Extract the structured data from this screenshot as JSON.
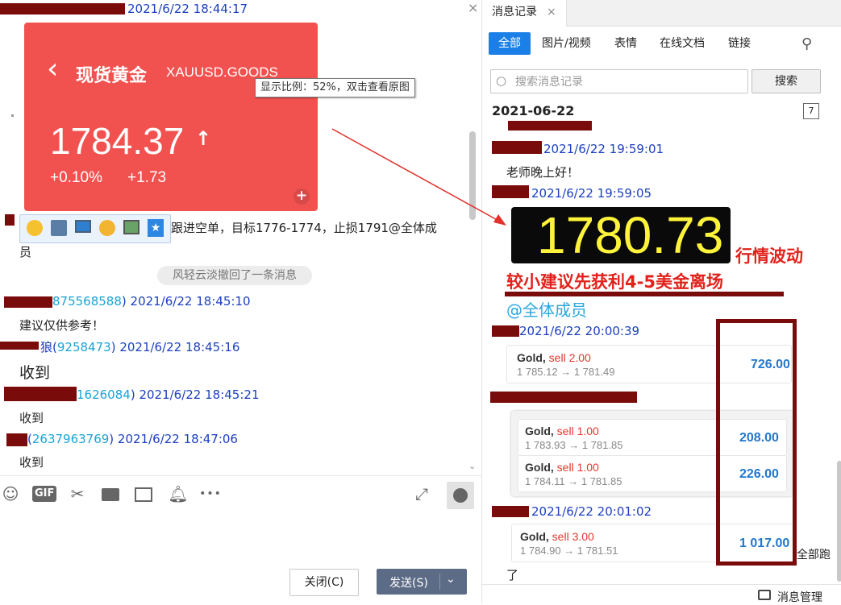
{
  "left": {
    "messages": [
      {
        "time": "2021/6/22 18:44:17"
      },
      {
        "text": "跟进空单，目标1776-1774，止损1791@全体成",
        "text2": "员"
      },
      {
        "recall": "风轻云淡撤回了一条消息"
      },
      {
        "id": "875568588",
        "time": "2021/6/22 18:45:10",
        "text": "建议仅供参考！"
      },
      {
        "prefix": "狼",
        "id": "9258473",
        "time": "2021/6/22 18:45:16",
        "text": "收到"
      },
      {
        "id": "1626084",
        "time": "2021/6/22 18:45:21",
        "text": "收到"
      },
      {
        "id": "2637963769",
        "time": "2021/6/22 18:47:06",
        "text": "收到"
      }
    ],
    "stock": {
      "back": "‹",
      "name": "现货黄金",
      "symbol": "XAUUSD.GOODS",
      "price": "1784.37",
      "arrow": "↑",
      "pct": "+0.10%",
      "change": "+1.73"
    },
    "tooltip": "显示比例：52%，双击查看原图",
    "toolbar": {
      "gif": "GIF",
      "more": "•••"
    },
    "close_label": "关闭(C)",
    "send_label": "发送(S)"
  },
  "right": {
    "tab_title": "消息记录",
    "filters": [
      "全部",
      "图片/视频",
      "表情",
      "在线文档",
      "链接"
    ],
    "search_placeholder": "搜索消息记录",
    "search_button": "搜索",
    "date": "2021-06-22",
    "calendar_num": "7",
    "messages": [
      {
        "time": "2021/6/22 19:59:01",
        "text": "老师晚上好！"
      },
      {
        "time": "2021/6/22 19:59:05"
      },
      {
        "time": "2021/6/22 20:00:39"
      },
      {
        "time": "2021/6/22 20:01:02",
        "text": "了"
      }
    ],
    "big_price": "1780.73",
    "big_label": "行情波动",
    "red_line": "较小建议先获利4-5美金离场",
    "mention": "@全体成员",
    "trades": [
      {
        "title": "Gold,",
        "sell": "sell 2.00",
        "price": "1 785.12 → 1 781.49",
        "value": "726.00"
      },
      {
        "title": "Gold,",
        "sell": "sell 1.00",
        "price": "1 783.93 → 1 781.85",
        "value": "208.00"
      },
      {
        "title": "Gold,",
        "sell": "sell 1.00",
        "price": "1 784.11 → 1 781.85",
        "value": "226.00"
      },
      {
        "title": "Gold,",
        "sell": "sell 3.00",
        "price": "1 784.90 → 1 781.51",
        "value": "1 017.00"
      }
    ],
    "side_note": "全部跑",
    "manage": "消息管理"
  }
}
